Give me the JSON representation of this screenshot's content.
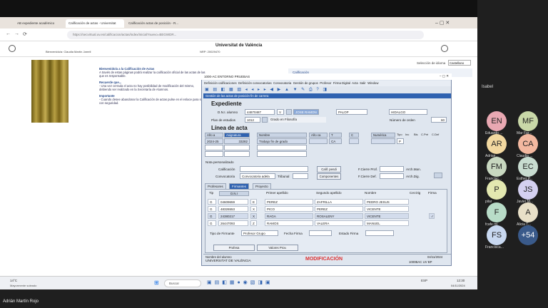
{
  "browser": {
    "tabs": [
      "AB expediente académico",
      "Calificación de actas - Universitat",
      "Calificación actas de posición - R..."
    ],
    "url": "https://secvirtual.uv.es/calificacion/actas/index/inicial?nuevo=BEGWDR..."
  },
  "uv": {
    "title": "Universitat de València",
    "welcome": "Bienvenido/a: Claudia Martín Jarrell",
    "nrp": "NRP: 20029470",
    "language_label": "Selección de idioma",
    "language_value": "Castellano",
    "s1": "Bienvenido/a a la Calificación de Actas",
    "s2": "A través de estas páginas podrá realizar la calificación oficial de las actas de las que es responsable.",
    "s3": "Recuerde que...",
    "s4": "- Una vez cerrada el acta no hay posibilidad de modificación del mismo, debiendo ser realizado en la Secretaría de Alumnos.",
    "s5": "Importante",
    "s6": "- Cuando desee abandonar la Calificación de actas pulse en el enlace para salir con seguridad.",
    "right_header": "Calificación"
  },
  "form": {
    "window_title": "1000-AC ENTORNO PRUEBAS",
    "menu": [
      "Definición calificaciones",
      "Definición convocatorias",
      "Convocatoria",
      "Gestión de grupos",
      "Profesor",
      "Firma Digital",
      "Acta",
      "Salir",
      "Window"
    ],
    "form_title": "Gestión de las actas de posición fin de carrera",
    "expediente": "Expediente",
    "dni_label": "D.N.I. alumno",
    "dni": "44870487",
    "dni_letter": "V",
    "nombre": "JOSE RAMON",
    "ap1": "PALOP",
    "ap2": "HIDALGO",
    "plan_label": "Plan de estudios",
    "plan": "1012",
    "plan_name": "Grado en Filosofía",
    "orden_label": "Número de orden",
    "orden": "60",
    "linea": "Línea de acta",
    "cols": [
      "Año a",
      "Asignatura",
      "Nombre",
      "Año ca",
      "T",
      "C",
      "Numérica",
      "Tipo",
      "Inc",
      "Bis",
      "C.Pré",
      "C.Def"
    ],
    "row": {
      "ano": "2024-25",
      "asig": "33282",
      "nombre": "Trabajo fin de grado",
      "tipo": "CA",
      "calif": "P"
    },
    "nota_label": "Nota personalizado",
    "calif_label": "Calificación",
    "calif_btn": "Calif. pendi",
    "conv_label": "Convocatoria",
    "conv_val": "Convocatoria adela",
    "tribunal": "Tribunal",
    "comp_btn": "Componentes",
    "cierre_prof": "F.Cierre Prof.",
    "cierre_def": "F.Cierre Def.",
    "arch_man": "Arch.Man.",
    "arch_dig": "Arch.Dig.",
    "tabs": [
      "Profesores",
      "Firmantes",
      "Proyecto"
    ],
    "fcols": [
      "Tip",
      "D.N.I",
      "Primer apellido",
      "Segundo apellido",
      "Nombre",
      "Cer.Dig",
      "Firma"
    ],
    "firmantes": [
      {
        "tip": "G",
        "dni": "04609659",
        "l": "E",
        "ap1": "PEREZ",
        "ap2": "ZAFRILLA",
        "nom": "PEDRO JESUS"
      },
      {
        "tip": "G",
        "dni": "48326553",
        "l": "X",
        "ap1": "PICO",
        "ap2": "PEREZ",
        "nom": "VICENTE"
      },
      {
        "tip": "G",
        "dni": "24380217",
        "l": "X",
        "ap1": "RAGA",
        "ap2": "ROSALENY",
        "nom": "VICENTE"
      },
      {
        "tip": "G",
        "dni": "26447093",
        "l": "Z",
        "ap1": "RAMOS",
        "ap2": "VALERA",
        "nom": "MANUEL"
      }
    ],
    "tipo_firm": "Tipo de Firmante",
    "tipo_firm_val": "Profesor Grupo",
    "fecha_firma": "Fecha Firma",
    "estado_firma": "Estado Firma",
    "btn_prof": "Profesa",
    "btn_val": "Valores Prov.",
    "status_l1": "Nombre del alumno",
    "status_l2": "UNIVERSITAT DE VALÈNCIA",
    "status_mode": "MODIFICACIÓN",
    "status_date": "04/11/2024",
    "status_code": "1000BAC UV BP"
  },
  "taskbar": {
    "weather": "14°C",
    "weather2": "Mayormente soleado",
    "search": "Buscar",
    "time": "12:30",
    "date": "04/11/2024",
    "lang": "ESP"
  },
  "presenter": "Adrián Martín Rojo",
  "meet": {
    "top": "Isabel",
    "people": [
      {
        "i": "EN",
        "n": "Eduardo ...",
        "c": "#e9a8b2"
      },
      {
        "i": "MF",
        "n": "Mar Far...",
        "c": "#c9d8a8"
      },
      {
        "i": "AR",
        "n": "Adrian...",
        "c": "#f2d8a0"
      },
      {
        "i": "CA",
        "n": "Claudia ...",
        "c": "#f3b8a0"
      },
      {
        "i": "FM",
        "n": "Francisc...",
        "c": "#c8d8c0"
      },
      {
        "i": "EC",
        "n": "Esther P...",
        "c": "#c8dcd0"
      },
      {
        "i": "P",
        "n": "pilar",
        "c": "#e3e8b0"
      },
      {
        "i": "JS",
        "n": "Javier M...",
        "c": "#d4d0f0"
      },
      {
        "i": "F",
        "n": "fcafe mj",
        "c": "#b8dcc8"
      },
      {
        "i": "A",
        "n": "Alicia T...",
        "c": "#e8e0c8"
      },
      {
        "i": "FS",
        "n": "Francisca...",
        "c": "#c8d8f0"
      },
      {
        "i": "+54",
        "n": "",
        "c": "#3a5a8a"
      }
    ]
  }
}
